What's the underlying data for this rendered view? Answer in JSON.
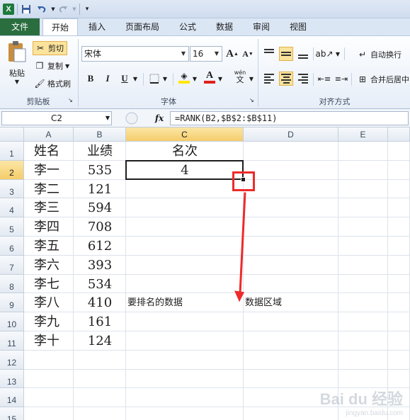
{
  "qat": {
    "app_icon_letter": "X",
    "icons": [
      "save-icon",
      "undo-icon",
      "redo-icon",
      "customize-qat-icon"
    ]
  },
  "tabs": [
    "文件",
    "开始",
    "插入",
    "页面布局",
    "公式",
    "数据",
    "审阅",
    "视图"
  ],
  "ribbon": {
    "clipboard": {
      "paste": "粘贴",
      "cut": "剪切",
      "copy": "复制",
      "format_painter": "格式刷",
      "label": "剪贴板"
    },
    "font": {
      "name": "宋体",
      "size": "16",
      "bold": "B",
      "italic": "I",
      "underline": "U",
      "grow": "A",
      "shrink": "A",
      "font_color_letter": "A",
      "wen": "wén",
      "label": "字体"
    },
    "alignment": {
      "wrap_text": "自动换行",
      "merge_center": "合并后居中",
      "label": "对齐方式"
    },
    "colors": {
      "highlight_yellow": "#ffe700",
      "font_red": "#e3201b",
      "file_tab_green": "#2a6e3f"
    }
  },
  "formula_bar": {
    "name_box": "C2",
    "fx": "fx",
    "formula": "=RANK(B2,$B$2:$B$11)"
  },
  "grid": {
    "columns": [
      "A",
      "B",
      "C",
      "D",
      "E"
    ],
    "rows": [
      "1",
      "2",
      "3",
      "4",
      "5",
      "6",
      "7",
      "8",
      "9",
      "10",
      "11",
      "12",
      "13",
      "14",
      "15"
    ],
    "header_row": {
      "A": "姓名",
      "B": "业绩",
      "C": "名次"
    },
    "data": [
      {
        "name": "李一",
        "score": "535",
        "rank": "4"
      },
      {
        "name": "李二",
        "score": "121",
        "rank": ""
      },
      {
        "name": "李三",
        "score": "594",
        "rank": ""
      },
      {
        "name": "李四",
        "score": "708",
        "rank": ""
      },
      {
        "name": "李五",
        "score": "612",
        "rank": ""
      },
      {
        "name": "李六",
        "score": "393",
        "rank": ""
      },
      {
        "name": "李七",
        "score": "534",
        "rank": ""
      },
      {
        "name": "李八",
        "score": "410",
        "rank": ""
      },
      {
        "name": "李九",
        "score": "161",
        "rank": ""
      },
      {
        "name": "李十",
        "score": "124",
        "rank": ""
      }
    ],
    "annotation_c9": "要排名的数据",
    "annotation_d9": "数据区域",
    "active_cell": "C2",
    "highlight_color": "#ee2a2a"
  },
  "watermark": {
    "brand": "Bai du 经验",
    "url": "jingyan.baidu.com"
  }
}
